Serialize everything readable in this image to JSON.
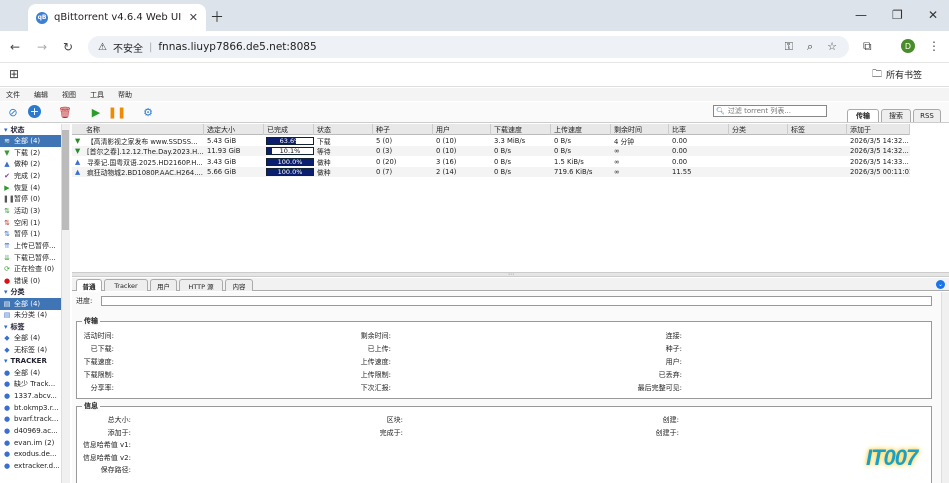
{
  "browser": {
    "tab_title": "qBittorrent v4.6.4 Web UI",
    "favicon_text": "qB",
    "security_label": "不安全",
    "url": "fnnas.liuyp7866.de5.net:8085",
    "profile_initial": "D",
    "all_bookmarks": "所有书签"
  },
  "menu": [
    "文件",
    "编辑",
    "视图",
    "工具",
    "帮助"
  ],
  "filter_placeholder": "过滤 torrent 列表...",
  "right_tabs": [
    "传输",
    "搜索",
    "RSS"
  ],
  "sidebar": {
    "status_header": "状态",
    "status": [
      {
        "label": "全部 (4)",
        "icon": "≋",
        "color": "#e07b00",
        "selected": true
      },
      {
        "label": "下载 (2)",
        "icon": "▼",
        "color": "#3a9a3a"
      },
      {
        "label": "做种 (2)",
        "icon": "▲",
        "color": "#3a6ed0"
      },
      {
        "label": "完成 (2)",
        "icon": "✔",
        "color": "#7a3ab0"
      },
      {
        "label": "恢复 (4)",
        "icon": "▶",
        "color": "#2a9a2a"
      },
      {
        "label": "暂停 (0)",
        "icon": "❚❚",
        "color": "#555"
      },
      {
        "label": "活动 (3)",
        "icon": "⇅",
        "color": "#3a9a3a"
      },
      {
        "label": "空闲 (1)",
        "icon": "⇅",
        "color": "#c0392b"
      },
      {
        "label": "暂停 (1)",
        "icon": "⇅",
        "color": "#3a6ed0"
      },
      {
        "label": "上传已暂停...",
        "icon": "⇈",
        "color": "#3a6ed0"
      },
      {
        "label": "下载已暂停...",
        "icon": "⇊",
        "color": "#3a9a3a"
      },
      {
        "label": "正在检查 (0)",
        "icon": "⟳",
        "color": "#3a9a3a"
      },
      {
        "label": "错误 (0)",
        "icon": "●",
        "color": "#d11"
      }
    ],
    "category_header": "分类",
    "categories": [
      {
        "label": "全部 (4)",
        "icon": "▤",
        "color": "#3a6ed0",
        "selected": true
      },
      {
        "label": "未分类 (4)",
        "icon": "▤",
        "color": "#3a6ed0"
      }
    ],
    "tag_header": "标签",
    "tags": [
      {
        "label": "全部 (4)",
        "icon": "◆",
        "color": "#3a6ed0"
      },
      {
        "label": "无标签 (4)",
        "icon": "◆",
        "color": "#3a6ed0"
      }
    ],
    "tracker_header": "TRACKER",
    "trackers": [
      {
        "label": "全部 (4)",
        "icon": "●",
        "color": "#3a6ed0"
      },
      {
        "label": "缺少 Track...",
        "icon": "●",
        "color": "#3a6ed0"
      },
      {
        "label": "1337.abcv...",
        "icon": "●",
        "color": "#3a6ed0"
      },
      {
        "label": "bt.okmp3.r...",
        "icon": "●",
        "color": "#3a6ed0"
      },
      {
        "label": "bvarf.track...",
        "icon": "●",
        "color": "#3a6ed0"
      },
      {
        "label": "d40969.ac...",
        "icon": "●",
        "color": "#3a6ed0"
      },
      {
        "label": "evan.im (2)",
        "icon": "●",
        "color": "#3a6ed0"
      },
      {
        "label": "exodus.de...",
        "icon": "●",
        "color": "#3a6ed0"
      },
      {
        "label": "extracker.d...",
        "icon": "●",
        "color": "#3a6ed0"
      }
    ]
  },
  "columns": [
    "名称",
    "选定大小",
    "已完成",
    "状态",
    "种子",
    "用户",
    "下载速度",
    "上传速度",
    "剩余时间",
    "比率",
    "分类",
    "标签",
    "添加于"
  ],
  "torrents": [
    {
      "name": "【高清影视之家发布 www.SSDSS...",
      "size": "5.43 GiB",
      "progress_text": "63.6%",
      "progress": 0.636,
      "state": "下载",
      "seeds": "5 (0)",
      "peers": "0 (10)",
      "dl": "3.3 MiB/s",
      "ul": "0 B/s",
      "eta": "4 分钟",
      "ratio": "0.00",
      "category": "",
      "tags": "",
      "added": "2026/3/5 14:32...",
      "icon": "▼",
      "icon_color": "#2a8a2a"
    },
    {
      "name": "[首尔之春].12.12.The.Day.2023.H...",
      "size": "11.93 GiB",
      "progress_text": "10.1%",
      "progress": 0.101,
      "state": "等待",
      "seeds": "0 (3)",
      "peers": "0 (10)",
      "dl": "0 B/s",
      "ul": "0 B/s",
      "eta": "∞",
      "ratio": "0.00",
      "category": "",
      "tags": "",
      "added": "2026/3/5 14:32...",
      "icon": "▼",
      "icon_color": "#2a8a2a"
    },
    {
      "name": "寻秦记.国粤双语.2025.HD2160P.H...",
      "size": "3.43 GiB",
      "progress_text": "100.0%",
      "progress": 1.0,
      "state": "做种",
      "seeds": "0 (20)",
      "peers": "3 (16)",
      "dl": "0 B/s",
      "ul": "1.5 KiB/s",
      "eta": "∞",
      "ratio": "0.00",
      "category": "",
      "tags": "",
      "added": "2026/3/5 14:33...",
      "icon": "▲",
      "icon_color": "#3a6ed0"
    },
    {
      "name": "疯狂动物城2.BD1080P.AAC.H264....",
      "size": "5.66 GiB",
      "progress_text": "100.0%",
      "progress": 1.0,
      "state": "做种",
      "seeds": "0 (7)",
      "peers": "2 (14)",
      "dl": "0 B/s",
      "ul": "719.6 KiB/s",
      "eta": "∞",
      "ratio": "11.55",
      "category": "",
      "tags": "",
      "added": "2026/3/5 00:11:01",
      "icon": "▲",
      "icon_color": "#3a6ed0"
    }
  ],
  "detail_tabs": [
    "普通",
    "Tracker",
    "用户",
    "HTTP 源",
    "内容"
  ],
  "detail": {
    "progress_label": "进度:",
    "transfer_legend": "传输",
    "transfer_col1": [
      "活动时间:",
      "已下载:",
      "下载速度:",
      "下载限制:",
      "分享率:"
    ],
    "transfer_col2": [
      "剩余时间:",
      "已上传:",
      "上传速度:",
      "上传限制:",
      "下次汇报:"
    ],
    "transfer_col3": [
      "连接:",
      "种子:",
      "用户:",
      "已丢弃:",
      "最后完整可见:"
    ],
    "info_legend": "信息",
    "info_col1": [
      "总大小:",
      "添加于:",
      "信息哈希值 v1:",
      "信息哈希值 v2:",
      "保存路径:"
    ],
    "info_col2": [
      "区块:",
      "完成于:"
    ],
    "info_col3": [
      "创建:",
      "创建于:"
    ]
  },
  "watermark": "IT007"
}
